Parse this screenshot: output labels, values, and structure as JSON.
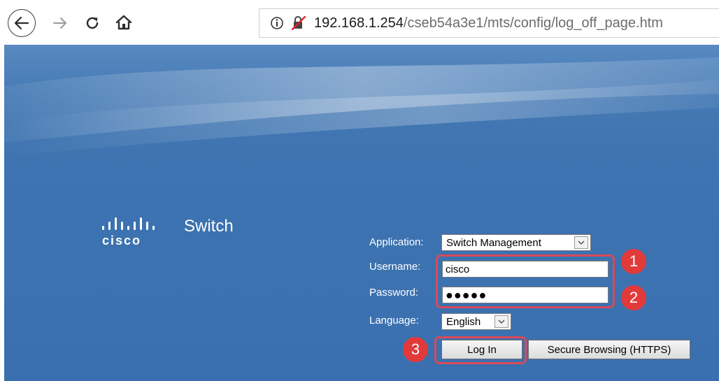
{
  "browser": {
    "url_host": "192.168.1.254",
    "url_path": "/cseb54a3e1/mts/config/log_off_page.htm"
  },
  "page": {
    "logo_text": "cisco",
    "product_name": "Switch"
  },
  "form": {
    "application_label": "Application:",
    "application_value": "Switch Management",
    "username_label": "Username:",
    "username_value": "cisco",
    "password_label": "Password:",
    "password_masked": "●●●●●",
    "language_label": "Language:",
    "language_value": "English",
    "login_label": "Log In",
    "secure_label": "Secure Browsing (HTTPS)"
  },
  "annotations": {
    "step1": "1",
    "step2": "2",
    "step3": "3",
    "highlight_color": "#d94a58",
    "badge_color": "#e23a3a"
  },
  "icons": [
    "back-arrow-icon",
    "forward-arrow-icon",
    "reload-icon",
    "home-icon",
    "info-icon",
    "insecure-lock-icon",
    "chevron-down-icon",
    "cisco-logo"
  ]
}
